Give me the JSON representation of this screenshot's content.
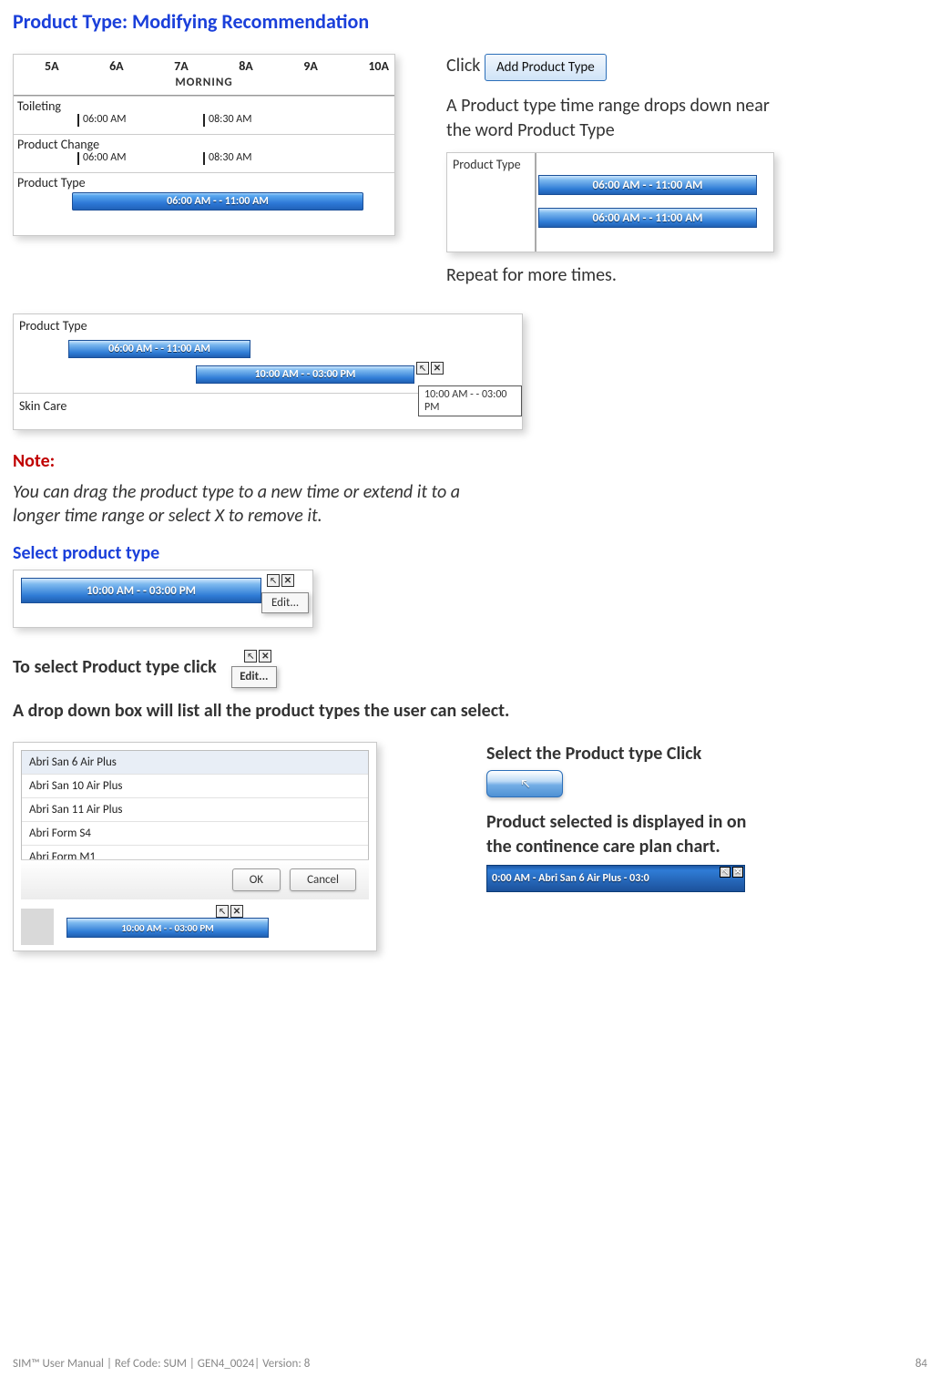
{
  "headings": {
    "section_title": "Product Type: Modifying Recommendation",
    "select_product_type": "Select product type",
    "note_label": "Note:"
  },
  "texts": {
    "click_word": "Click",
    "add_button": "Add Product Type",
    "drops_down": "A Product type time range drops down near the word Product Type",
    "repeat": "Repeat for more times.",
    "note_body": "You can drag the product type to a new time or extend it to a longer time range or select X to remove it.",
    "to_select": "To select Product type click",
    "drop_down_list": "A drop down box will list all the product types the user can select.",
    "select_click": "Select the Product type Click",
    "product_selected": "Product selected is displayed in on the continence care plan chart."
  },
  "timeline": {
    "headers": [
      "5A",
      "6A",
      "7A",
      "8A",
      "9A",
      "10A"
    ],
    "morning_label": "MORNING",
    "rows": {
      "toileting": "Toileting",
      "product_change": "Product Change",
      "product_type": "Product Type"
    },
    "tick_a": "06:00 AM",
    "tick_b": "08:30 AM",
    "bar_main": "06:00 AM -  - 11:00 AM"
  },
  "pt_panel": {
    "label": "Product Type",
    "row1": "06:00 AM -  - 11:00 AM",
    "row2": "06:00 AM -  - 11:00 AM"
  },
  "strip": {
    "label_pt": "Product Type",
    "label_sc": "Skin Care",
    "bar1": "06:00 AM -  - 11:00 AM",
    "bar2": "10:00 AM -  - 03:00 PM",
    "tooltip": "10:00 AM -  - 03:00 PM"
  },
  "editbar": {
    "bar_text": "10:00 AM -  - 03:00 PM",
    "edit_menu": "Edit..."
  },
  "inline_edit": {
    "menu": "Edit..."
  },
  "product_list": {
    "items": [
      "Abri San 6 Air Plus",
      "Abri San 10 Air Plus",
      "Abri San 11 Air Plus",
      "Abri Form S4",
      "Abri Form M1"
    ],
    "ok": "OK",
    "cancel": "Cancel",
    "mini_bar": "10:00 AM -  - 03:00 PM"
  },
  "finalbar": {
    "text": "0:00 AM - Abri San 6 Air Plus - 03:0"
  },
  "footer": {
    "left": "SIM™ User Manual | Ref Code: SUM | GEN4_0024| Version: 8",
    "right": "84"
  }
}
